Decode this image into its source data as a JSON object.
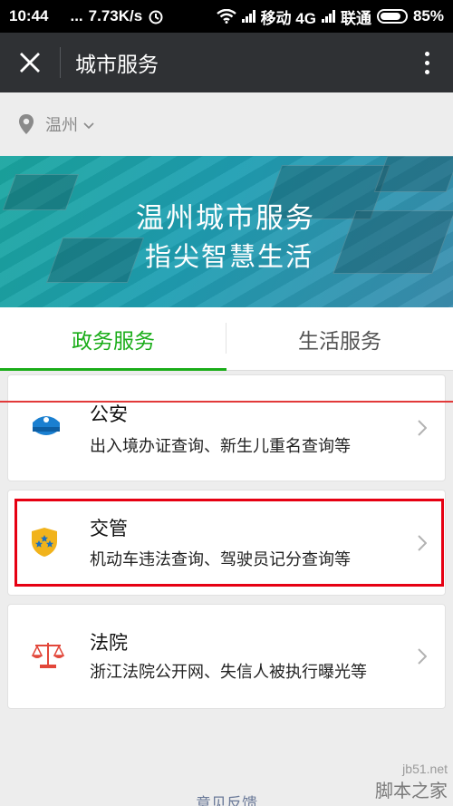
{
  "status_bar": {
    "time": "10:44",
    "dots": "...",
    "speed": "7.73K/s",
    "carrier1": "移动 4G",
    "carrier2": "联通",
    "battery": "85%"
  },
  "nav": {
    "title": "城市服务"
  },
  "location": {
    "city": "温州"
  },
  "banner": {
    "title": "温州城市服务",
    "subtitle": "指尖智慧生活"
  },
  "tabs": [
    {
      "label": "政务服务",
      "active": true
    },
    {
      "label": "生活服务",
      "active": false
    }
  ],
  "services": [
    {
      "name": "公安",
      "desc": "出入境办证查询、新生儿重名查询等",
      "icon": "police-cap-icon"
    },
    {
      "name": "交管",
      "desc": "机动车违法查询、驾驶员记分查询等",
      "icon": "traffic-badge-icon"
    },
    {
      "name": "法院",
      "desc": "浙江法院公开网、失信人被执行曝光等",
      "icon": "scales-icon"
    }
  ],
  "footer": {
    "feedback": "意见反馈"
  },
  "watermark": {
    "site": "jb51.net",
    "name": "脚本之家"
  },
  "colors": {
    "accent": "#1aad19",
    "nav_bg": "#2f3134",
    "highlight": "#e60012"
  }
}
